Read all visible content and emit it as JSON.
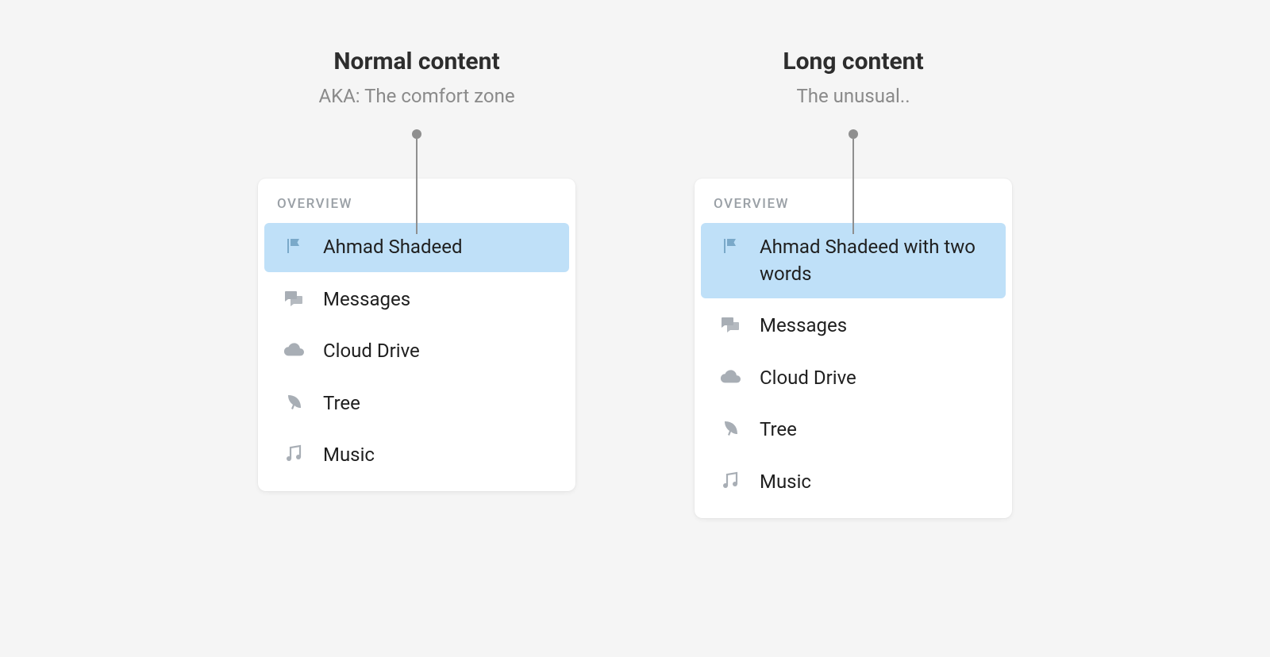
{
  "columns": [
    {
      "title": "Normal content",
      "subtitle": "AKA: The comfort zone",
      "section_label": "OVERVIEW",
      "items": [
        {
          "icon": "flag",
          "label": "Ahmad Shadeed",
          "active": true
        },
        {
          "icon": "messages",
          "label": "Messages"
        },
        {
          "icon": "cloud",
          "label": "Cloud Drive"
        },
        {
          "icon": "leaf",
          "label": "Tree"
        },
        {
          "icon": "music",
          "label": "Music"
        }
      ]
    },
    {
      "title": "Long content",
      "subtitle": "The unusual..",
      "section_label": "OVERVIEW",
      "items": [
        {
          "icon": "flag",
          "label": "Ahmad Shadeed with two words",
          "active": true
        },
        {
          "icon": "messages",
          "label": "Messages"
        },
        {
          "icon": "cloud",
          "label": "Cloud Drive"
        },
        {
          "icon": "leaf",
          "label": "Tree"
        },
        {
          "icon": "music",
          "label": "Music"
        }
      ]
    }
  ]
}
